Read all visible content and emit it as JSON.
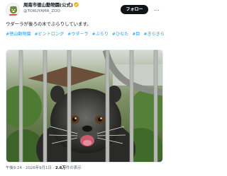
{
  "account": {
    "display_name": "周南市徳山動物園(公式)",
    "handle": "@TOKUYAMA_ZOO",
    "verified_icon": "verified-badge-icon",
    "avatar_icon": "zoo-logo-avatar"
  },
  "actions": {
    "follow_label": "フォロー",
    "more_label": "…"
  },
  "tweet": {
    "text": "ウダーラが後ろの木でぶらりしています。",
    "hashtags": [
      "#徳山動物園",
      "#ビントロング",
      "#ウダーラ",
      "#ぶらり",
      "#ひなた",
      "#目",
      "#きらきら"
    ]
  },
  "media": {
    "icon": "binturong-photo",
    "accent_colors": {
      "fur": "#3a3a3a",
      "foliage": "#4f7a34",
      "bars": "#b7b9b5"
    }
  },
  "meta": {
    "time": "午後9:24",
    "separator": "·",
    "date": "2026年9月1日",
    "views_count": "2.6万",
    "views_label": "件の表示"
  },
  "colors": {
    "accent": "#1d9bf0",
    "text": "#0f1419",
    "secondary": "#536471",
    "follow_bg": "#0f1419"
  }
}
